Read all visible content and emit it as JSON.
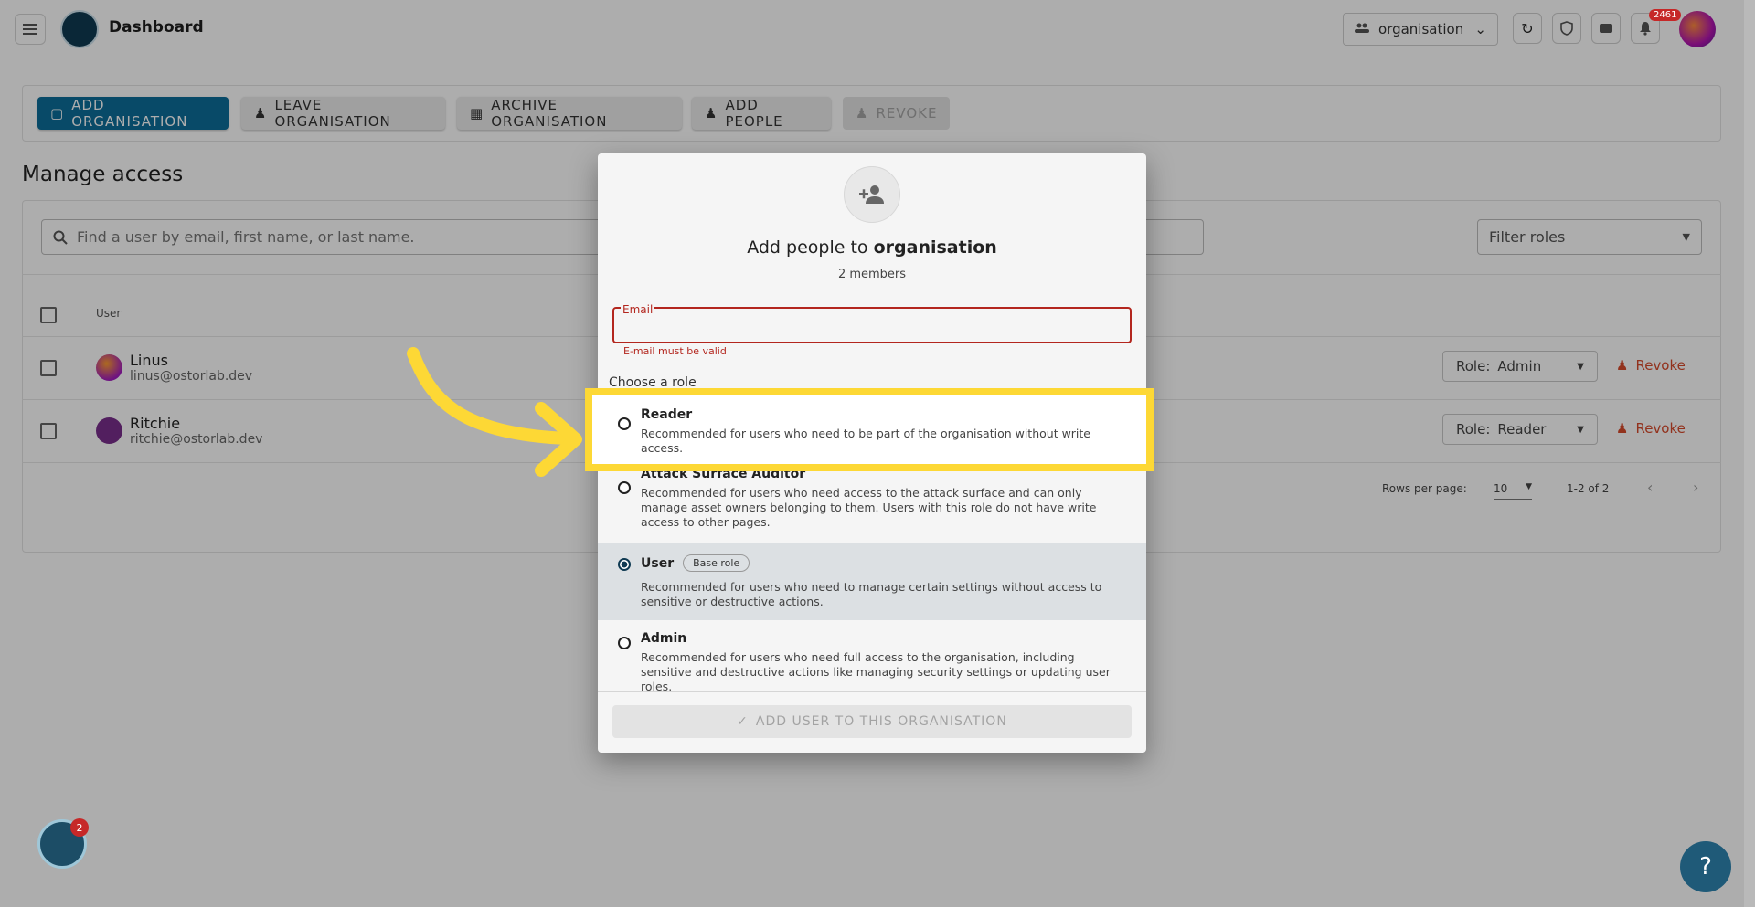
{
  "header": {
    "title": "Dashboard",
    "org_selector": "organisation",
    "notification_count": "2461"
  },
  "toolbar": {
    "add_organisation": "ADD ORGANISATION",
    "leave_organisation": "LEAVE ORGANISATION",
    "archive_organisation": "ARCHIVE ORGANISATION",
    "add_people": "ADD PEOPLE",
    "revoke": "REVOKE"
  },
  "page": {
    "title": "Manage access",
    "search_placeholder": "Find a user by email, first name, or last name.",
    "filter_roles": "Filter roles",
    "table_header_user": "User",
    "rows": [
      {
        "name": "Linus",
        "email": "linus@ostorlab.dev",
        "role_prefix": "Role:",
        "role": "Admin",
        "revoke": "Revoke"
      },
      {
        "name": "Ritchie",
        "email": "ritchie@ostorlab.dev",
        "role_prefix": "Role:",
        "role": "Reader",
        "revoke": "Revoke"
      }
    ],
    "pagination": {
      "rows_per_page_label": "Rows per page:",
      "rows_per_page": "10",
      "range": "1-2 of 2"
    }
  },
  "dialog": {
    "title_prefix": "Add people to",
    "title_org": "organisation",
    "members": "2 members",
    "email_label": "Email",
    "email_error": "E-mail must be valid",
    "choose_role": "Choose a role",
    "roles": [
      {
        "name": "Reader",
        "description": "Recommended for users who need to be part of the organisation without write access.",
        "selected": false
      },
      {
        "name": "Attack Surface Auditor",
        "description": "Recommended for users who need access to the attack surface and can only manage asset owners belonging to them. Users with this role do not have write access to other pages.",
        "selected": false
      },
      {
        "name": "User",
        "badge": "Base role",
        "description": "Recommended for users who need to manage certain settings without access to sensitive or destructive actions.",
        "selected": true
      },
      {
        "name": "Admin",
        "description": "Recommended for users who need full access to the organisation, including sensitive and destructive actions like managing security settings or updating user roles.",
        "selected": false
      }
    ],
    "submit": "ADD USER TO THIS ORGANISATION"
  },
  "widgets": {
    "chat_badge": "2",
    "help": "?"
  },
  "colors": {
    "primary": "#0d6e9a",
    "error": "#b3261e",
    "highlight": "#fdd835",
    "revoke": "#d84a2c"
  }
}
